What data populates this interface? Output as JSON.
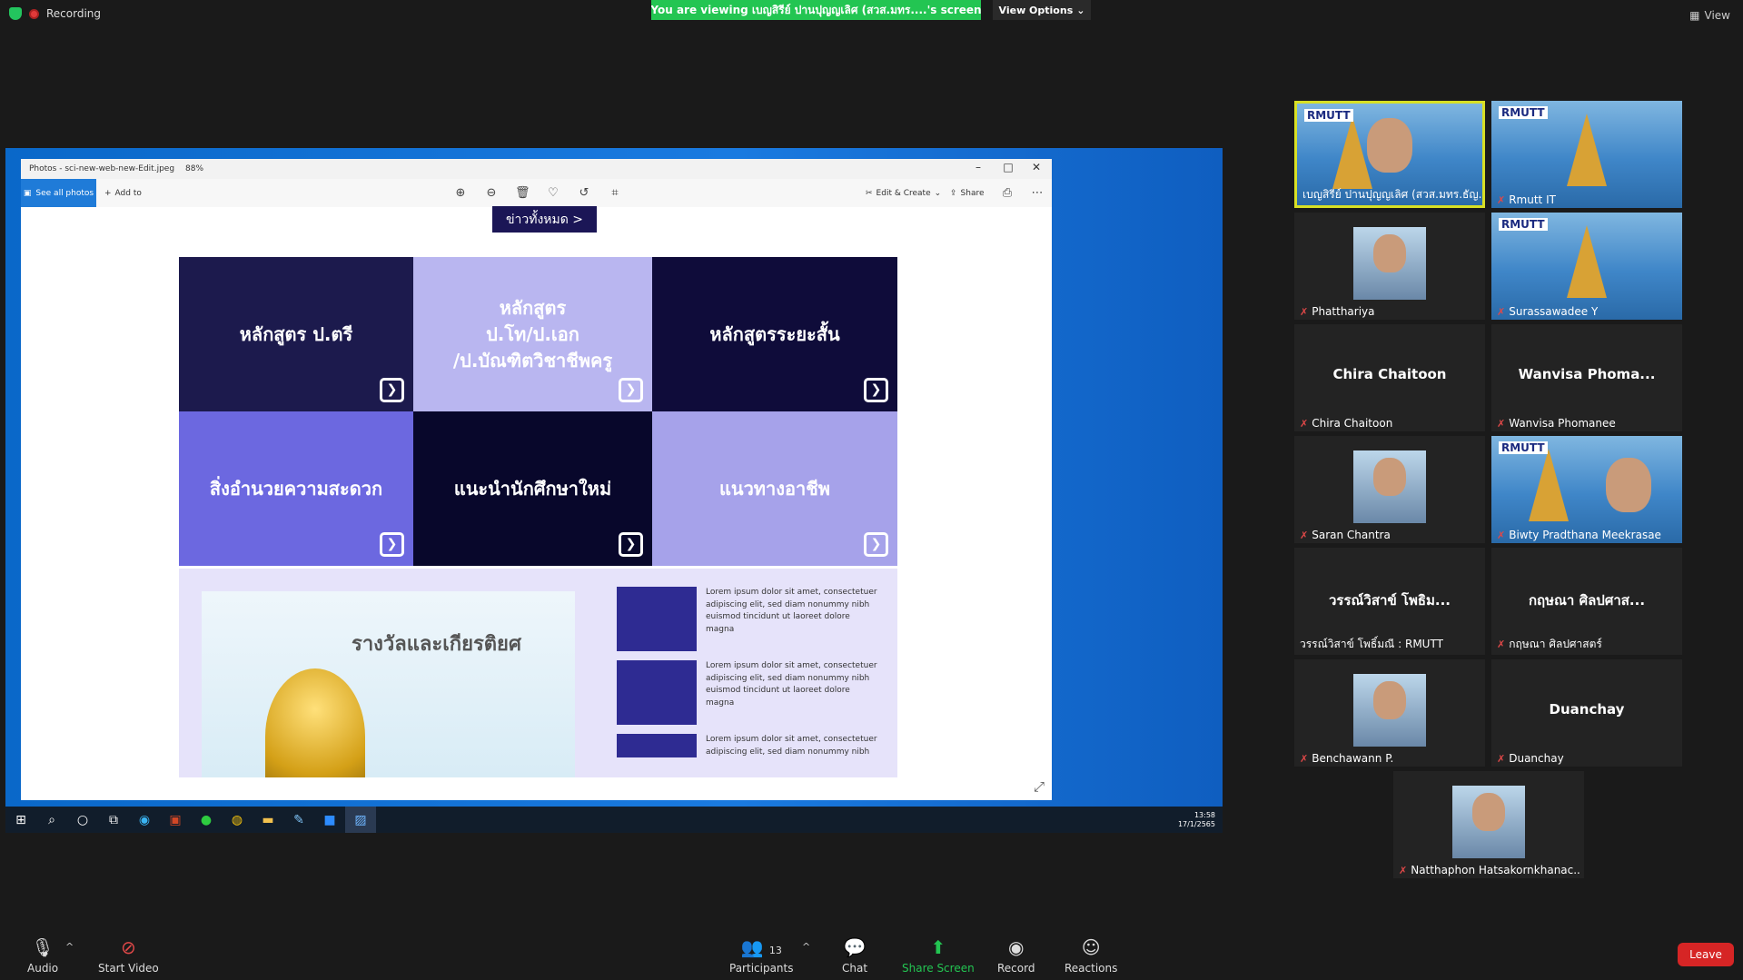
{
  "top": {
    "recording": "Recording",
    "viewing_banner": "You are viewing เบญสิรีย์ ปานปุญญเลิศ (สวส.มทร....'s screen",
    "view_options": "View Options",
    "view": "View"
  },
  "photos": {
    "title": "Photos - sci-new-web-new-Edit.jpeg",
    "zoom": "88%",
    "see_all": "See all photos",
    "add_to": "Add to",
    "edit_create": "Edit & Create",
    "share": "Share"
  },
  "webpage": {
    "view_all": "ข่าวทั้งหมด >",
    "tiles": [
      {
        "label": "หลักสูตร ป.ตรี",
        "bg": "#1c1a4d"
      },
      {
        "label": "หลักสูตร\nป.โท/ป.เอก\n/ป.บัณฑิตวิชาชีพครู",
        "bg": "#b9b6f0",
        "fg": "#1c1a4d"
      },
      {
        "label": "หลักสูตรระยะสั้น",
        "bg": "#0f0c3a"
      },
      {
        "label": "สิ่งอำนวยความสะดวก",
        "bg": "#6c68e0",
        "fg": "#0f0c3a"
      },
      {
        "label": "แนะนำนักศึกษาใหม่",
        "bg": "#08072b"
      },
      {
        "label": "แนวทางอาชีพ",
        "bg": "#a6a2ea",
        "fg": "#1c1a4d"
      }
    ],
    "award_title": "รางวัลและเกียรติยศ",
    "news": [
      "Lorem ipsum dolor sit amet, consectetuer adipiscing elit, sed diam nonummy nibh euismod tincidunt ut laoreet dolore magna",
      "Lorem ipsum dolor sit amet, consectetuer adipiscing elit, sed diam nonummy nibh euismod tincidunt ut laoreet dolore magna",
      "Lorem ipsum dolor sit amet, consectetuer adipiscing elit, sed diam nonummy nibh"
    ]
  },
  "taskbar": {
    "time": "13:58",
    "date": "17/1/2565"
  },
  "gallery": [
    {
      "name": "เบญสิรีย์ ปานปุญญเลิศ (สวส.มทร.ธัญ...",
      "type": "bg-person",
      "active": true,
      "muted": false
    },
    {
      "name": "Rmutt IT",
      "type": "bg",
      "muted": true
    },
    {
      "name": "Phatthariya",
      "type": "photo",
      "muted": true
    },
    {
      "name": "Surassawadee Y",
      "type": "bg",
      "muted": true
    },
    {
      "name": "Chira Chaitoon",
      "center": "Chira Chaitoon",
      "type": "none",
      "muted": true
    },
    {
      "name": "Wanvisa Phomanee",
      "center": "Wanvisa  Phoma...",
      "type": "none",
      "muted": true
    },
    {
      "name": "Saran Chantra",
      "type": "photo",
      "muted": true
    },
    {
      "name": "Biwty Pradthana Meekrasae",
      "type": "bg-person",
      "muted": true
    },
    {
      "name": "วรรณ์วิสาข์ โพธิ์มณี : RMUTT",
      "center": "วรรณ์วิสาข์ โพธิม...",
      "type": "none",
      "muted": false
    },
    {
      "name": "กฤษณา ศิลปศาสตร์",
      "center": "กฤษณา ศิลปศาส...",
      "type": "none",
      "muted": true
    },
    {
      "name": "Benchawann P.",
      "type": "photo",
      "muted": true
    },
    {
      "name": "Duanchay",
      "center": "Duanchay",
      "type": "none",
      "muted": true
    },
    {
      "name": "Natthaphon Hatsakornkhanac...",
      "type": "photo",
      "muted": true
    }
  ],
  "bottom": {
    "audio": "Audio",
    "start_video": "Start Video",
    "participants": "Participants",
    "participants_count": "13",
    "chat": "Chat",
    "share_screen": "Share Screen",
    "record": "Record",
    "reactions": "Reactions",
    "leave": "Leave"
  }
}
